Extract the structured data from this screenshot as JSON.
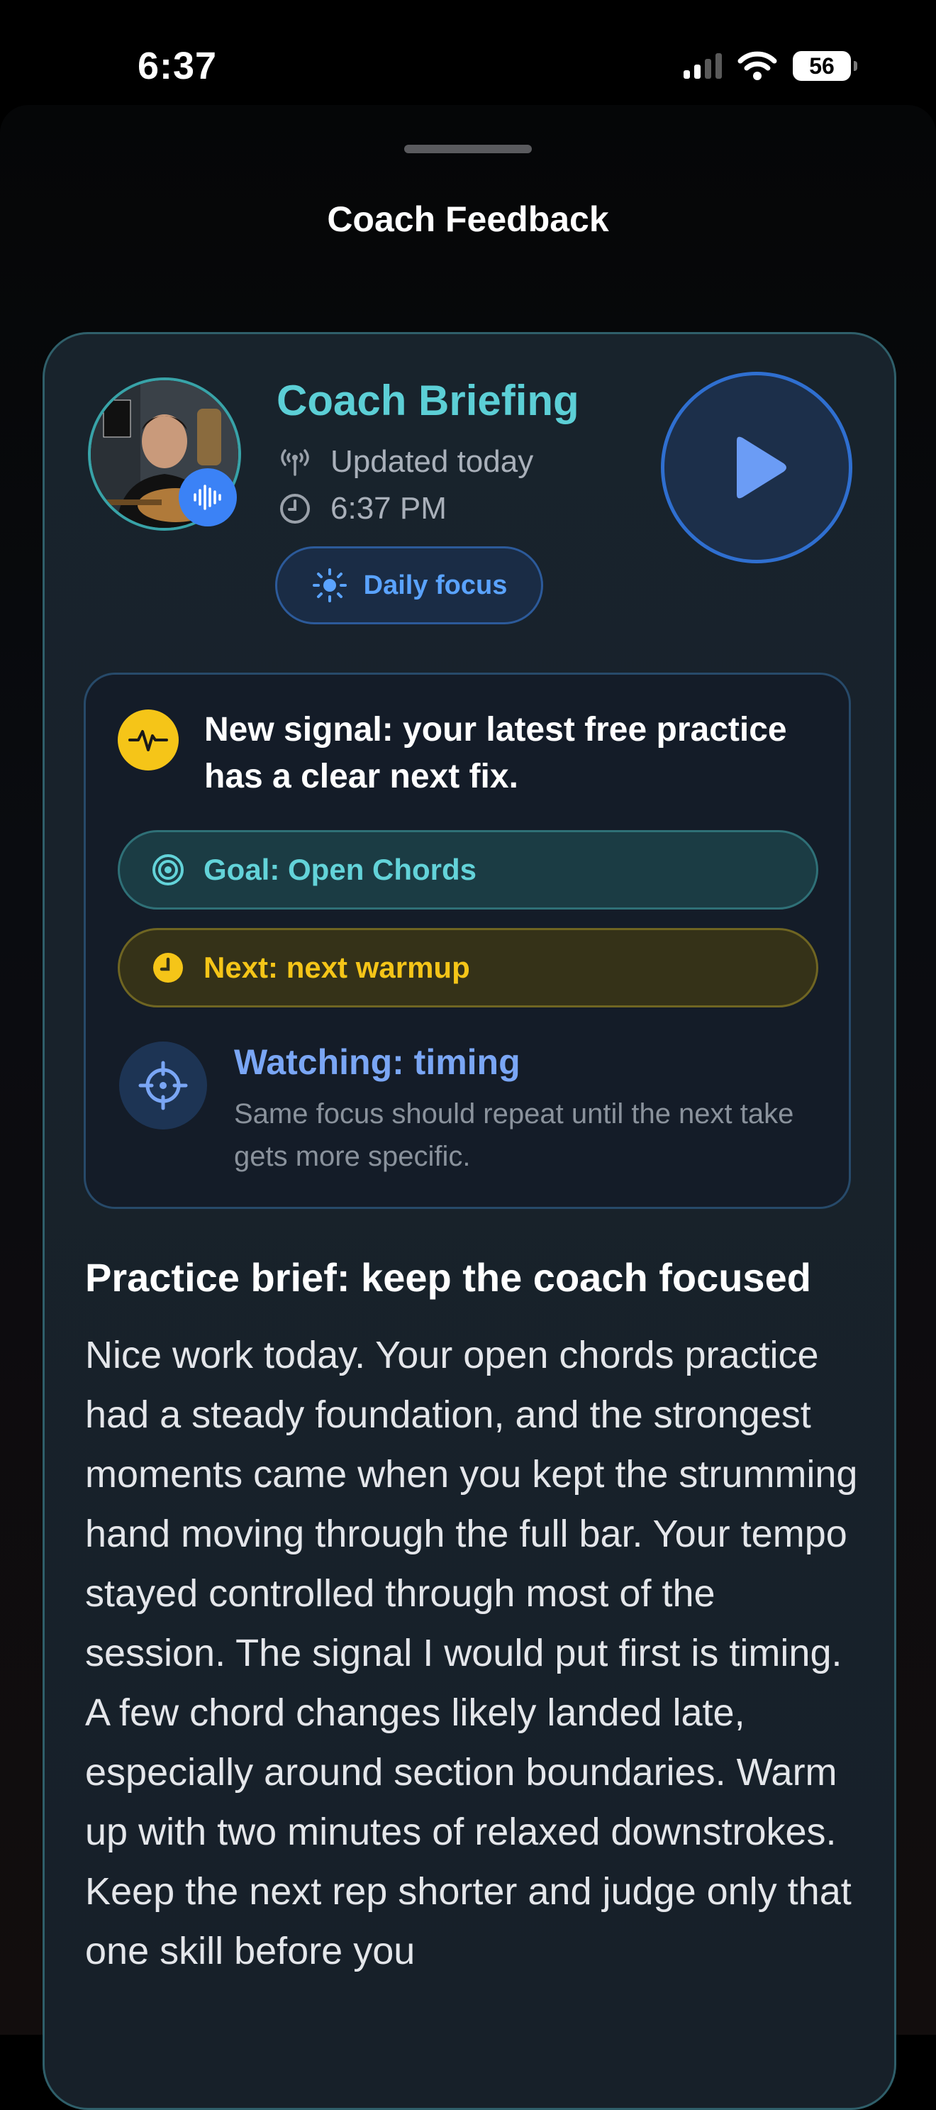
{
  "status_bar": {
    "time": "6:37",
    "battery": "56"
  },
  "sheet": {
    "title": "Coach Feedback"
  },
  "briefing": {
    "title": "Coach Briefing",
    "updated": "Updated today",
    "time": "6:37 PM",
    "focus_chip": "Daily focus"
  },
  "signal": {
    "text": "New signal: your latest free practice has a clear next fix.",
    "goal": "Goal: Open Chords",
    "next": "Next: next warmup",
    "watching_title": "Watching: timing",
    "watching_desc": "Same focus should repeat until the next take gets more specific."
  },
  "practice": {
    "title": "Practice brief: keep the coach focused",
    "body": "Nice work today. Your open chords practice had a steady foundation, and the strongest moments came when you kept the strumming hand moving through the full bar. Your tempo stayed controlled through most of the session. The signal I would put first is timing. A few chord changes likely landed late, especially around section boundaries. Warm up with two minutes of relaxed downstrokes. Keep the next rep shorter and judge only that one skill before you"
  },
  "colors": {
    "accent_teal": "#5ccfd6",
    "accent_blue": "#3b82f6",
    "accent_yellow": "#f5c518"
  }
}
